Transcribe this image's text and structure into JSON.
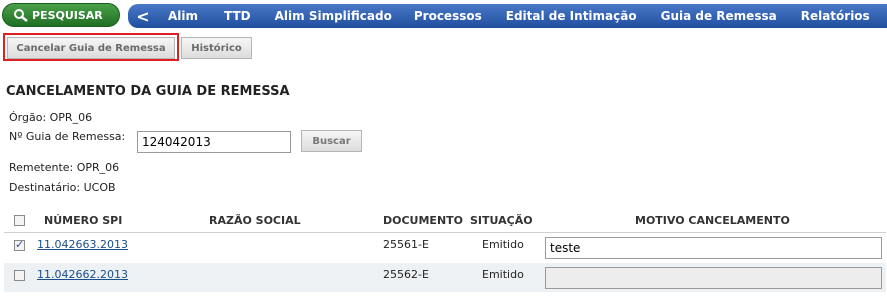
{
  "header": {
    "search_label": "PESQUISAR",
    "back_glyph": "<",
    "nav": [
      "Alim",
      "TTD",
      "Alim Simplificado",
      "Processos",
      "Edital de Intimação",
      "Guia de Remessa",
      "Relatórios"
    ]
  },
  "tabs": {
    "cancel_label": "Cancelar Guia de Remessa",
    "history_label": "Histórico"
  },
  "page": {
    "title": "CANCELAMENTO DA GUIA DE REMESSA",
    "orgao": "Órgão: OPR_06",
    "guia_label": "Nº Guia de Remessa:",
    "guia_value": "124042013",
    "buscar_label": "Buscar",
    "remetente": "Remetente: OPR_06",
    "destinatario": "Destinatário: UCOB"
  },
  "table": {
    "headers": {
      "numero": "NÚMERO SPI",
      "razao": "RAZÃO SOCIAL",
      "documento": "DOCUMENTO",
      "situacao": "SITUAÇÃO",
      "motivo": "MOTIVO CANCELAMENTO"
    },
    "rows": [
      {
        "checked": true,
        "numero": "11.042663.2013",
        "razao": "",
        "documento": "25561-E",
        "situacao": "Emitido",
        "motivo": "teste"
      },
      {
        "checked": false,
        "numero": "11.042662.2013",
        "razao": "",
        "documento": "25562-E",
        "situacao": "Emitido",
        "motivo": ""
      }
    ]
  },
  "colors": {
    "nav_blue": "#1f4f9e",
    "search_green": "#2e7d32",
    "highlight_red": "#e02020",
    "link": "#1a4f8a"
  }
}
